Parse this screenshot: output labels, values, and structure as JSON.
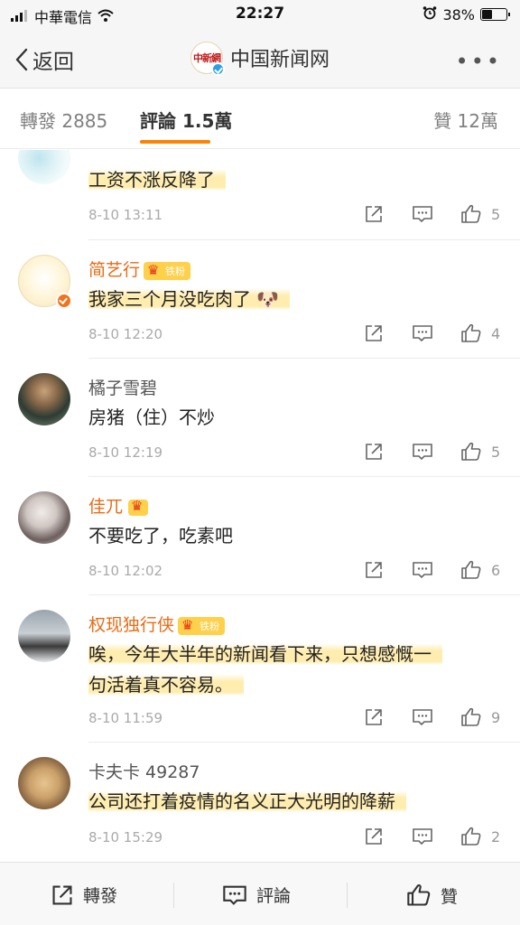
{
  "status_bar": {
    "carrier": "中華電信",
    "time": "22:27",
    "battery_percent": "38%",
    "battery_level": 0.38
  },
  "nav": {
    "back_label": "返回",
    "title": "中国新闻网",
    "logo_text": "中新網",
    "more_icon": "more-dots-icon"
  },
  "tabs": {
    "repost": "轉發 2885",
    "comments": "評論 1.5萬",
    "likes": "贊 12萬"
  },
  "comments": [
    {
      "username": "",
      "text": "工资不涨反降了",
      "time": "8-10 13:11",
      "likes": "5",
      "highlight": true
    },
    {
      "username": "简艺行",
      "badge": "铁粉",
      "text": "我家三个月没吃肉了",
      "emoji": "🐶",
      "time": "8-10 12:20",
      "likes": "4",
      "highlight": true
    },
    {
      "username": "橘子雪碧",
      "text": "房猪（住）不炒",
      "time": "8-10 12:19",
      "likes": "5",
      "highlight": false
    },
    {
      "username": "佳兀",
      "text": "不要吃了，吃素吧",
      "time": "8-10 12:02",
      "likes": "6",
      "highlight": false
    },
    {
      "username": "权现独行侠",
      "badge": "铁粉",
      "text_line1": "唉，今年大半年的新闻看下来，只想感慨一",
      "text_line2": "句活着真不容易。",
      "time": "8-10 11:59",
      "likes": "9",
      "highlight": true
    },
    {
      "username": "卡夫卡 49287",
      "text": "公司还打着疫情的名义正大光明的降薪",
      "time": "8-10 15:29",
      "likes": "2",
      "highlight": true
    }
  ],
  "bottom_bar": {
    "repost": "轉發",
    "comment": "評論",
    "like": "贊"
  },
  "colors": {
    "accent": "#ff8200",
    "username_highlight": "#e86b15",
    "highlight": "#ffe796"
  }
}
